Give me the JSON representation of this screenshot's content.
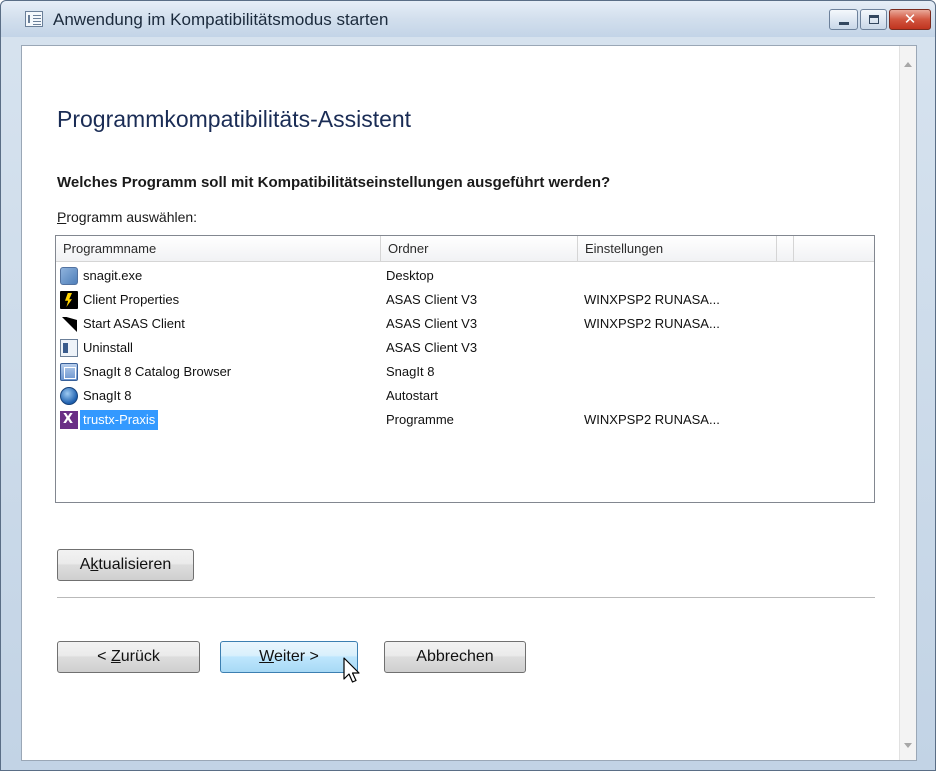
{
  "window": {
    "title": "Anwendung im Kompatibilitätsmodus starten",
    "close_glyph": "✕"
  },
  "heading": "Programmkompatibilitäts-Assistent",
  "question": "Welches Programm soll mit Kompatibilitätseinstellungen ausgeführt werden?",
  "select_label": {
    "accel": "P",
    "rest": "rogramm auswählen:"
  },
  "list": {
    "columns": [
      "Programmname",
      "Ordner",
      "Einstellungen",
      ""
    ],
    "rows": [
      {
        "icon": "snagit-exe-icon",
        "name": "snagit.exe",
        "folder": "Desktop",
        "settings": ""
      },
      {
        "icon": "lightning-bolt-icon",
        "name": "Client Properties",
        "folder": "ASAS Client V3",
        "settings": "WINXPSP2 RUNASA..."
      },
      {
        "icon": "black-arrow-icon",
        "name": "Start ASAS Client",
        "folder": "ASAS Client V3",
        "settings": "WINXPSP2 RUNASA..."
      },
      {
        "icon": "uninstall-icon",
        "name": "Uninstall",
        "folder": "ASAS Client V3",
        "settings": ""
      },
      {
        "icon": "catalog-browser-icon",
        "name": "SnagIt 8 Catalog Browser",
        "folder": "SnagIt 8",
        "settings": ""
      },
      {
        "icon": "snagit-icon",
        "name": "SnagIt 8",
        "folder": "Autostart",
        "settings": ""
      },
      {
        "icon": "trustx-icon",
        "name": "trustx-Praxis",
        "folder": "Programme",
        "settings": "WINXPSP2 RUNASA...",
        "selected": true
      }
    ]
  },
  "buttons": {
    "refresh": {
      "pre": "A",
      "accel": "k",
      "post": "tualisieren"
    },
    "back": {
      "pre": "< ",
      "accel": "Z",
      "post": "urück"
    },
    "next": {
      "pre": "",
      "accel": "W",
      "post": "eiter >"
    },
    "cancel": {
      "label": "Abbrechen"
    }
  },
  "colors": {
    "selection": "#3399ff",
    "heading": "#1a2c55",
    "close_button": "#c0341f"
  }
}
